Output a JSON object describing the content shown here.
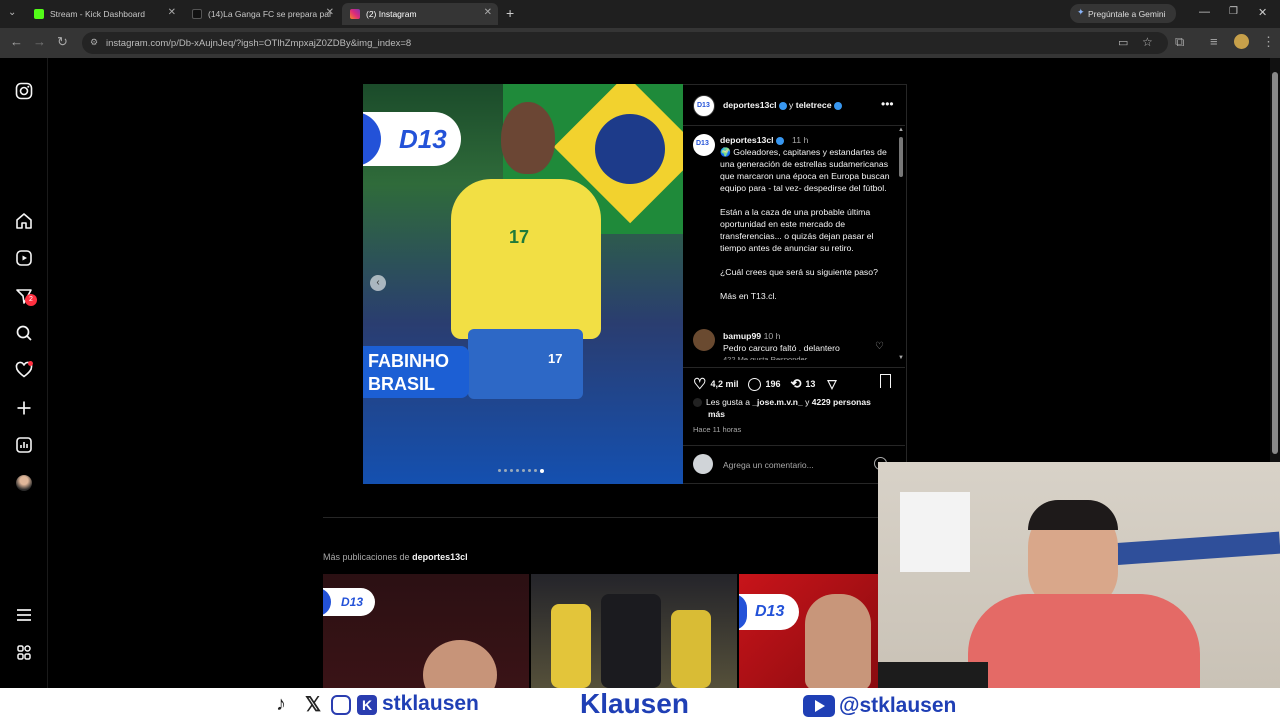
{
  "browser": {
    "tabs": [
      {
        "title": "Stream - Kick Dashboard",
        "favcolor": "#53fc18"
      },
      {
        "title": "(14)La Ganga FC se prepara par",
        "favcolor": "#111111"
      },
      {
        "title": "(2) Instagram",
        "favcolor": "#e1306c"
      }
    ],
    "new_tab": "+",
    "gemini": "Pregúntale a Gemini",
    "url": "instagram.com/p/Db-xAujnJeq/?igsh=OTlhZmpxajZ0ZDBy&img_index=8"
  },
  "rail": {
    "notification_count": "2"
  },
  "post": {
    "badge": "D13",
    "player_name_line1": "FABINHO",
    "player_name_line2": "BRASIL",
    "jersey_number": "17",
    "header_user": "deportes13cl",
    "header_connector": "y",
    "header_collab": "teletrece",
    "caption_user": "deportes13cl",
    "caption_time": "11 h",
    "caption_p1": "🌍 Goleadores, capitanes y estandartes de una generación de estrellas sudamericanas que marcaron una época en Europa buscan equipo para - tal vez- despedirse del fútbol.",
    "caption_p2": "Están a la caza de una probable última oportunidad en este mercado de transferencias... o quizás dejan pasar el tiempo antes de anunciar su retiro.",
    "caption_p3": "¿Cuál crees que será su siguiente paso?",
    "caption_p4": "Más en T13.cl.",
    "comment_user": "bamup99",
    "comment_time": "10 h",
    "comment_text": "Pedro carcuro faltó . delantero",
    "comment_meta": "422 Me gusta   Responder",
    "likes": "4,2 mil",
    "comments": "196",
    "reposts": "13",
    "liked_by_prefix": "Les gusta a",
    "liked_by_user": "_jose.m.v.n_",
    "liked_by_suffix": "y",
    "liked_by_count": "4229 personas",
    "liked_by_more": "más",
    "time_ago": "Hace 11 horas",
    "comment_placeholder": "Agrega un comentario..."
  },
  "more": {
    "prefix": "Más publicaciones de",
    "user": "deportes13cl",
    "badges": [
      "D13",
      "D13"
    ]
  },
  "banner": {
    "social_handle": "stklausen",
    "center": "Klausen",
    "youtube_handle": "@stklausen"
  }
}
